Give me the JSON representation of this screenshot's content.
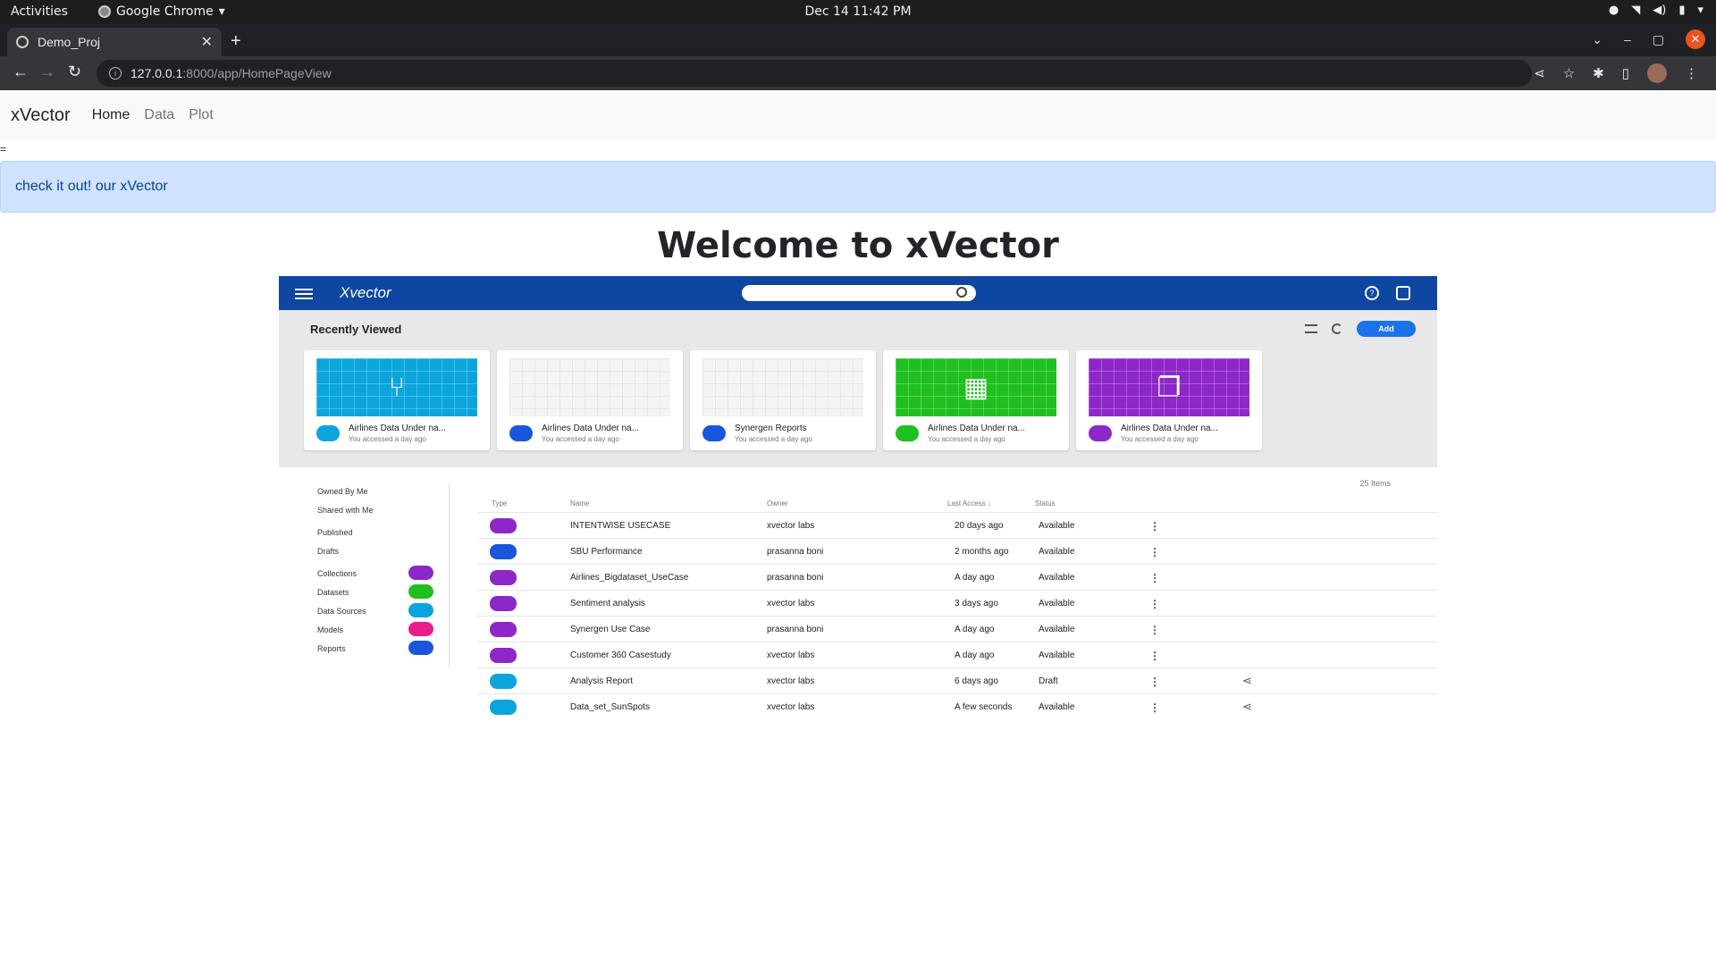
{
  "os": {
    "activities": "Activities",
    "app_name": "Google Chrome",
    "clock": "Dec 14  11:42 PM"
  },
  "browser": {
    "tab_title": "Demo_Proj",
    "url_host": "127.0.0.1",
    "url_path": ":8000/app/HomePageView"
  },
  "nav": {
    "brand": "xVector",
    "links": [
      "Home",
      "Data",
      "Plot"
    ]
  },
  "stray_text": "=",
  "alert": "check it out! our xVector",
  "heading": "Welcome to xVector",
  "embedded": {
    "logo": "Xvector",
    "recently_viewed": "Recently Viewed",
    "add_label": "Add",
    "cards": [
      {
        "name": "Airlines Data Under na...",
        "sub": "You accessed a day ago",
        "color": "#0aa5dc",
        "glyph": "⑂",
        "icon_color": "#0aa5dc"
      },
      {
        "name": "Airlines Data Under na...",
        "sub": "You accessed a day ago",
        "color": "#f4f4f4",
        "glyph": "",
        "icon_color": "#1a56db"
      },
      {
        "name": "Synergen Reports",
        "sub": "You accessed a day ago",
        "color": "#f4f4f4",
        "glyph": "",
        "icon_color": "#1a56db"
      },
      {
        "name": "Airlines Data Under na...",
        "sub": "You accessed a day ago",
        "color": "#1fbf1f",
        "glyph": "▦",
        "icon_color": "#1fbf1f"
      },
      {
        "name": "Airlines Data Under na...",
        "sub": "You accessed a day ago",
        "color": "#8d27c9",
        "glyph": "❐",
        "icon_color": "#8d27c9"
      }
    ],
    "item_count": "25 Items",
    "sidebar": [
      {
        "label": "Owned By Me",
        "badge": ""
      },
      {
        "label": "Shared with Me",
        "badge": ""
      },
      {
        "label": "Published",
        "badge": ""
      },
      {
        "label": "Drafts",
        "badge": ""
      },
      {
        "label": "Collections",
        "badge": "#8d27c9"
      },
      {
        "label": "Datasets",
        "badge": "#1fbf1f"
      },
      {
        "label": "Data Sources",
        "badge": "#0aa5dc"
      },
      {
        "label": "Models",
        "badge": "#e91e8c"
      },
      {
        "label": "Reports",
        "badge": "#1a56db"
      }
    ],
    "columns": [
      "Type",
      "Name",
      "Owner",
      "Last Access ↓",
      "Status"
    ],
    "rows": [
      {
        "name": "INTENTWISE USECASE",
        "owner": "xvector labs",
        "access": "20 days ago",
        "status": "Available",
        "color": "#8d27c9",
        "share": false
      },
      {
        "name": "SBU Performance",
        "owner": "prasanna boni",
        "access": "2 months ago",
        "status": "Available",
        "color": "#1a56db",
        "share": false
      },
      {
        "name": "Airlines_Bigdataset_UseCase",
        "owner": "prasanna boni",
        "access": "A day ago",
        "status": "Available",
        "color": "#8d27c9",
        "share": false
      },
      {
        "name": "Sentiment analysis",
        "owner": "xvector labs",
        "access": "3 days ago",
        "status": "Available",
        "color": "#8d27c9",
        "share": false
      },
      {
        "name": "Synergen Use Case",
        "owner": "prasanna boni",
        "access": "A day ago",
        "status": "Available",
        "color": "#8d27c9",
        "share": false
      },
      {
        "name": "Customer 360 Casestudy",
        "owner": "xvector labs",
        "access": "A day ago",
        "status": "Available",
        "color": "#8d27c9",
        "share": false
      },
      {
        "name": "Analysis Report",
        "owner": "xvector labs",
        "access": "6 days ago",
        "status": "Draft",
        "color": "#0aa5dc",
        "share": true
      },
      {
        "name": "Data_set_SunSpots",
        "owner": "xvector labs",
        "access": "A few seconds",
        "status": "Available",
        "color": "#0aa5dc",
        "share": true
      }
    ]
  }
}
